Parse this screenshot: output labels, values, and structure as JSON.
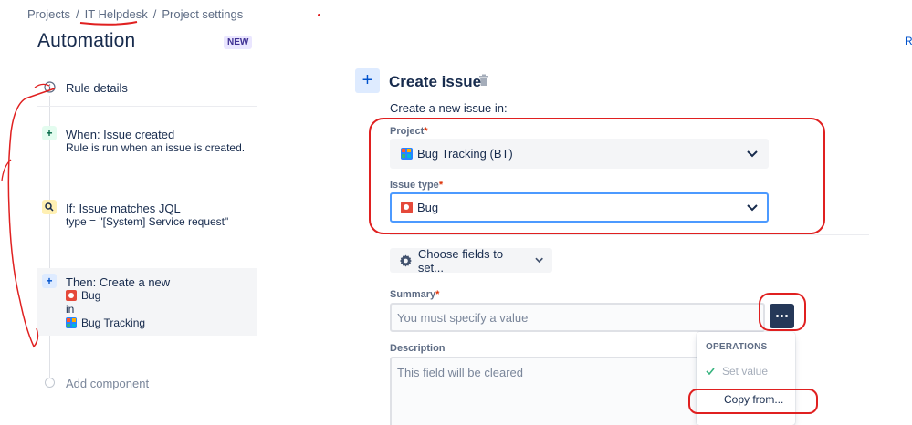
{
  "breadcrumb": {
    "items": [
      "Projects",
      "IT Helpdesk",
      "Project settings"
    ],
    "separator": "/"
  },
  "page": {
    "title": "Automation",
    "badge": "NEW",
    "right_cut_text": "R"
  },
  "rule": {
    "details_label": "Rule details",
    "trigger": {
      "title": "When: Issue created",
      "desc": "Rule is run when an issue is created."
    },
    "condition": {
      "title": "If: Issue matches JQL",
      "desc": "type = \"[System] Service request\""
    },
    "action": {
      "title": "Then: Create a new",
      "issue_type": "Bug",
      "in": "in",
      "project": "Bug Tracking"
    },
    "add_component": "Add component"
  },
  "form": {
    "title": "Create issue",
    "intro": "Create a new issue in:",
    "project_label": "Project",
    "project_value": "Bug Tracking (BT)",
    "issue_type_label": "Issue type",
    "issue_type_value": "Bug",
    "required_marker": "*",
    "choose_fields": "Choose fields to set...",
    "summary_label": "Summary",
    "summary_placeholder": "You must specify a value",
    "description_label": "Description",
    "description_placeholder": "This field will be cleared"
  },
  "operations_menu": {
    "heading": "OPERATIONS",
    "items": [
      "Set value",
      "Copy from..."
    ]
  },
  "icons": {
    "details": "info-icon",
    "trigger": "plus-icon",
    "condition": "search-icon",
    "action": "plus-icon",
    "add_form": "plus-icon",
    "delete": "trash-icon",
    "select": "chevron-down-icon",
    "choose_fields": "gear-icon",
    "more": "more-icon",
    "check": "check-icon",
    "issue_type": "bug-icon",
    "project": "project-icon"
  },
  "colors": {
    "accent": "#0052cc",
    "annotation": "#e02020",
    "bug": "#e5493a",
    "trigger_bg": "#e3fcef",
    "condition_bg": "#fff0b3",
    "action_bg": "#deebff"
  }
}
